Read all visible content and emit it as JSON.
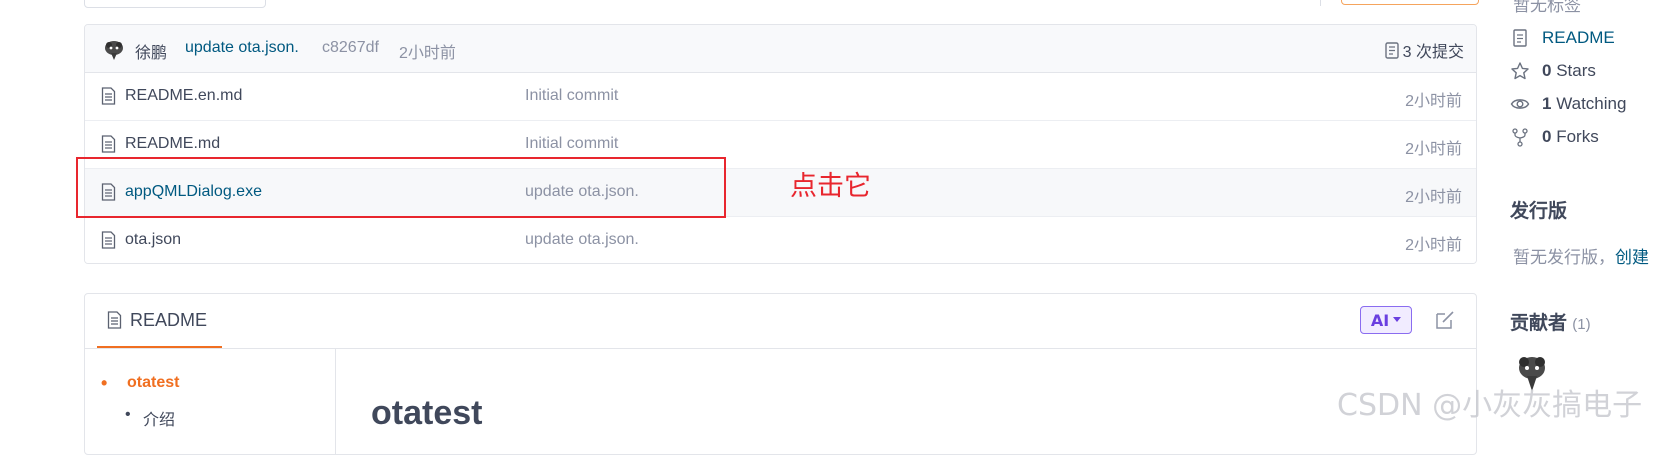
{
  "latest_commit": {
    "author": "徐鹏",
    "message": "update ota.json.",
    "sha": "c8267df",
    "time": "2小时前",
    "count_label": "3 次提交"
  },
  "files": [
    {
      "name": "README.en.md",
      "commit": "Initial commit",
      "time": "2小时前"
    },
    {
      "name": "README.md",
      "commit": "Initial commit",
      "time": "2小时前"
    },
    {
      "name": "appQMLDialog.exe",
      "commit": "update ota.json.",
      "time": "2小时前"
    },
    {
      "name": "ota.json",
      "commit": "update ota.json.",
      "time": "2小时前"
    }
  ],
  "annotation": {
    "text": "点击它",
    "color": "#e8262e"
  },
  "readme": {
    "tab_label": "README",
    "ai_label": "AI",
    "toc": [
      "otatest",
      "介绍"
    ],
    "title": "otatest"
  },
  "sidebar": {
    "top_text": "暂无标签",
    "readme_link": "README",
    "stars": {
      "count": "0",
      "label": "Stars"
    },
    "watching": {
      "count": "1",
      "label": "Watching"
    },
    "forks": {
      "count": "0",
      "label": "Forks"
    },
    "release_heading": "发行版",
    "release_text": "暂无发行版，",
    "release_link": "创建",
    "contributors_heading": "贡献者",
    "contributors_count": "(1)"
  },
  "watermark": "CSDN @小灰灰搞电子",
  "colors": {
    "accent": "#f06f21",
    "link": "#005980",
    "muted": "#8c92a4",
    "annotation": "#e8262e"
  }
}
